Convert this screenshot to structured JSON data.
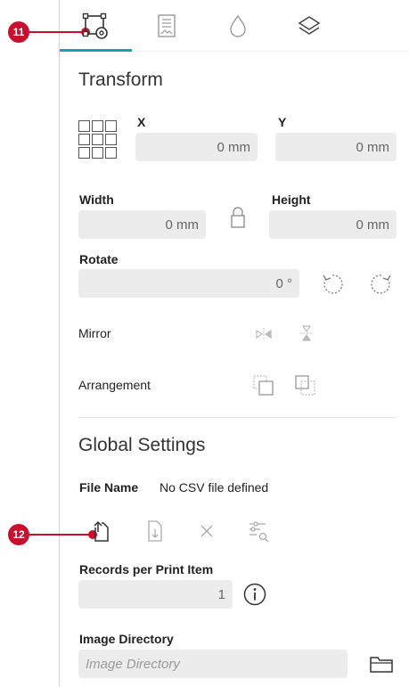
{
  "callouts": {
    "top": "11",
    "bottom": "12"
  },
  "tabs": [
    {
      "icon": "transform-settings-icon",
      "active": true
    },
    {
      "icon": "document-image-icon",
      "active": false
    },
    {
      "icon": "drop-icon",
      "active": false
    },
    {
      "icon": "layers-icon",
      "active": false
    }
  ],
  "transform": {
    "title": "Transform",
    "x_label": "X",
    "x_value": "0 mm",
    "y_label": "Y",
    "y_value": "0 mm",
    "width_label": "Width",
    "width_value": "0 mm",
    "height_label": "Height",
    "height_value": "0 mm",
    "rotate_label": "Rotate",
    "rotate_value": "0 °",
    "mirror_label": "Mirror",
    "arrangement_label": "Arrangement"
  },
  "global": {
    "title": "Global Settings",
    "file_name_label": "File Name",
    "file_name_value": "No CSV file defined",
    "records_label": "Records per Print Item",
    "records_value": "1",
    "image_dir_label": "Image Directory",
    "image_dir_placeholder": "Image Directory"
  },
  "colors": {
    "accent": "#19a2b6",
    "callout": "#c8102e"
  }
}
